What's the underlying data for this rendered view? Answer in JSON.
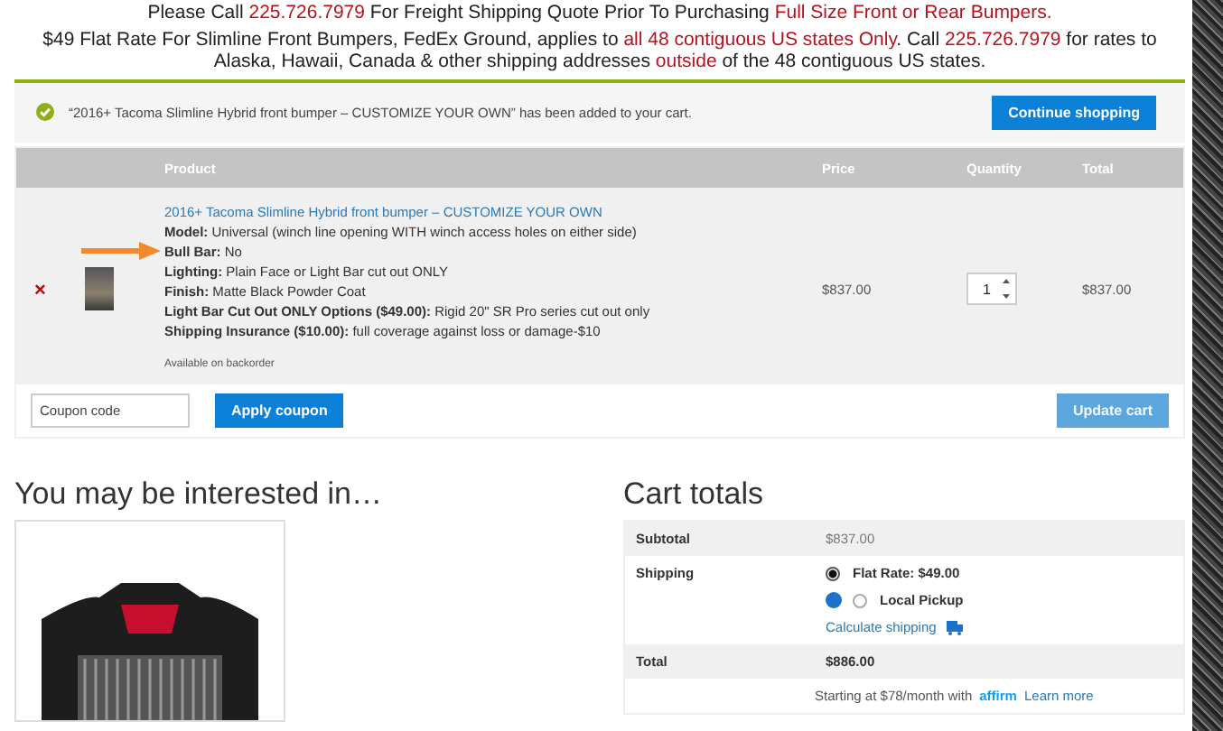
{
  "shipping_notices": [
    {
      "segments": [
        {
          "text": "Please Call ",
          "highlight": false
        },
        {
          "text": "225.726.7979",
          "highlight": true
        },
        {
          "text": " For Freight Shipping Quote Prior To Purchasing ",
          "highlight": false
        },
        {
          "text": "Full Size Front or Rear Bumpers.",
          "highlight": true
        }
      ]
    },
    {
      "segments": [
        {
          "text": "$49 Flat Rate For Slimline Front Bumpers, FedEx Ground, applies to ",
          "highlight": false
        },
        {
          "text": "all 48 contiguous US states Only",
          "highlight": true
        },
        {
          "text": ". Call ",
          "highlight": false
        },
        {
          "text": "225.726.7979",
          "highlight": true
        },
        {
          "text": " for rates to Alaska, Hawaii, Canada & other shipping addresses ",
          "highlight": false
        },
        {
          "text": "outside",
          "highlight": true
        },
        {
          "text": " of the 48 contiguous US states.",
          "highlight": false
        }
      ]
    }
  ],
  "cart_message": {
    "text": "“2016+ Tacoma Slimline Hybrid front bumper – CUSTOMIZE YOUR OWN” has been added to your cart.",
    "button": "Continue shopping"
  },
  "cart_table": {
    "columns": [
      "Product",
      "Price",
      "Quantity",
      "Total"
    ],
    "rows": [
      {
        "remove": "×",
        "name": "2016+ Tacoma Slimline Hybrid front bumper – CUSTOMIZE YOUR OWN",
        "details": [
          {
            "label": "Model:",
            "value": "Universal (winch line opening WITH winch access holes on either side)",
            "pointed": false
          },
          {
            "label": "Bull Bar:",
            "value": "No",
            "pointed": true
          },
          {
            "label": "Lighting:",
            "value": "Plain Face or Light Bar cut out ONLY",
            "pointed": false
          },
          {
            "label": "Finish:",
            "value": "Matte Black Powder Coat",
            "pointed": false
          },
          {
            "label": "Light Bar Cut Out ONLY Options ($49.00):",
            "value": "Rigid 20\" SR Pro series cut out only",
            "pointed": false
          },
          {
            "label": "Shipping Insurance ($10.00):",
            "value": "full coverage against loss or damage-$10",
            "pointed": false
          }
        ],
        "availability": "Available on backorder",
        "price": "$837.00",
        "quantity": "1",
        "total": "$837.00"
      }
    ],
    "coupon_placeholder": "Coupon code",
    "apply_button": "Apply coupon",
    "update_button": {
      "label": "Update cart",
      "disabled": true
    }
  },
  "related": {
    "heading": "You may be interested in…"
  },
  "cart_totals": {
    "heading": "Cart totals",
    "subtotal_label": "Subtotal",
    "subtotal": "$837.00",
    "shipping_label": "Shipping",
    "shipping_options": [
      {
        "label": "Flat Rate: $49.00",
        "selected": true,
        "help": false
      },
      {
        "label": "Local Pickup",
        "selected": false,
        "help": true
      }
    ],
    "calculate_link": "Calculate shipping",
    "total_label": "Total",
    "total": "$886.00",
    "financing": {
      "prefix": "Starting at $78/month with",
      "brand": "affirm",
      "link": "Learn more"
    }
  }
}
